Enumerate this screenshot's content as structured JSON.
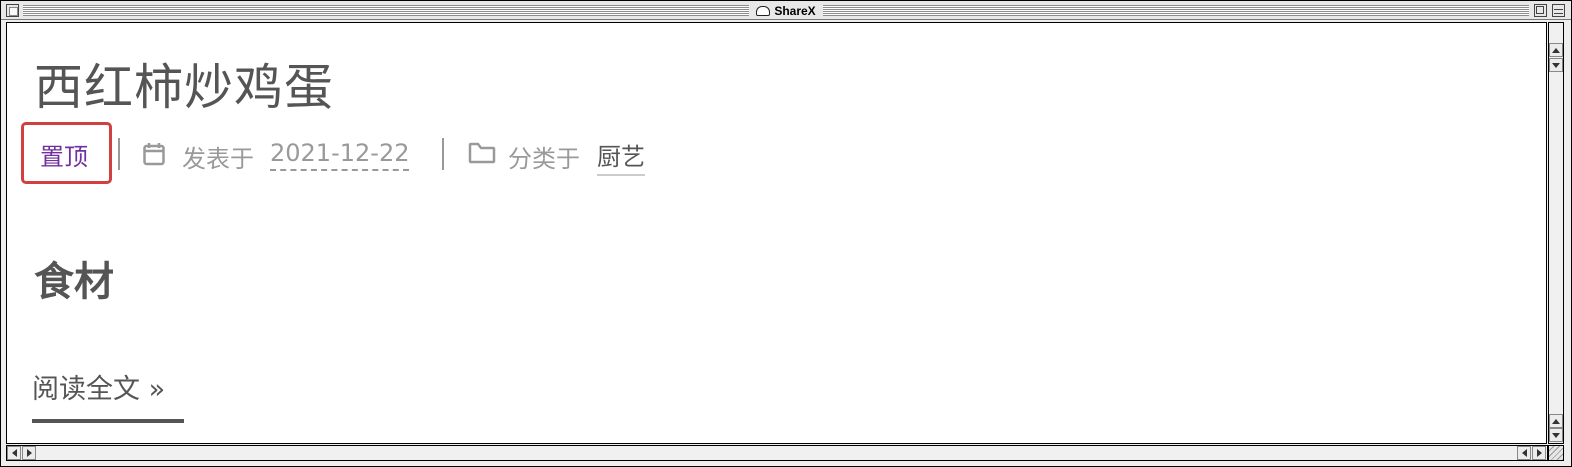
{
  "window": {
    "title": "ShareX"
  },
  "post": {
    "title": "西红柿炒鸡蛋",
    "sticky_label": "置顶",
    "posted_label": "发表于",
    "posted_date": "2021-12-22",
    "category_label": "分类于",
    "category": "厨艺",
    "section_heading": "食材",
    "read_more": "阅读全文 »"
  },
  "icons": {
    "calendar": "calendar-icon",
    "folder": "folder-icon"
  },
  "colors": {
    "sticky_text": "#7030a0",
    "highlight_border": "#d04040",
    "meta_text": "#999999",
    "body_text": "#555555"
  }
}
